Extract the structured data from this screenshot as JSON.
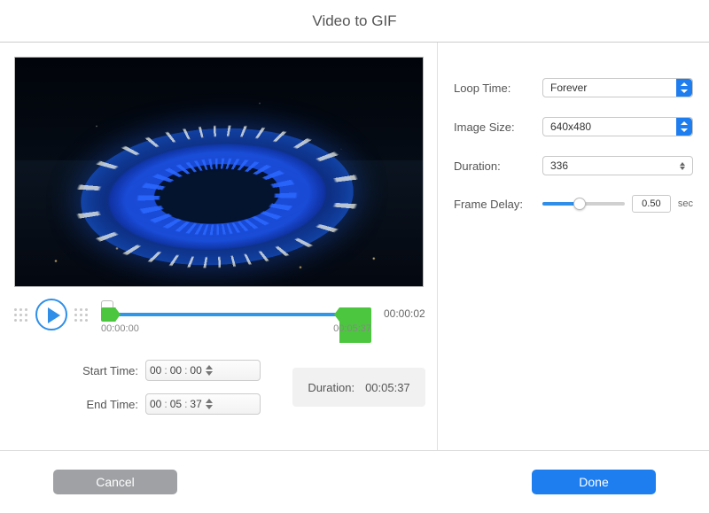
{
  "title": "Video to GIF",
  "timeline": {
    "current": "00:00:02",
    "start": "00:00:00",
    "end": "00:05:37"
  },
  "start_time": {
    "label": "Start Time:",
    "hh": "00",
    "mm": "00",
    "ss": "00"
  },
  "end_time": {
    "label": "End Time:",
    "hh": "00",
    "mm": "05",
    "ss": "37"
  },
  "clip_duration": {
    "label": "Duration:",
    "value": "00:05:37"
  },
  "settings": {
    "loop_time": {
      "label": "Loop Time:",
      "value": "Forever"
    },
    "image_size": {
      "label": "Image Size:",
      "value": "640x480"
    },
    "duration": {
      "label": "Duration:",
      "value": "336"
    },
    "frame_delay": {
      "label": "Frame Delay:",
      "value": "0.50",
      "unit": "sec",
      "slider_pct": 45
    }
  },
  "buttons": {
    "cancel": "Cancel",
    "done": "Done"
  }
}
